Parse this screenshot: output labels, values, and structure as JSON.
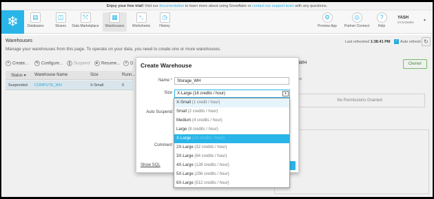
{
  "banner": {
    "lead": "Enjoy your free trial!",
    "pre": " Visit our ",
    "doc_link": "documentation",
    "mid": " to learn more about using Snowflake or ",
    "support_link": "contact our support team",
    "post": " with any questions."
  },
  "nav": {
    "logo": "❄",
    "items": [
      {
        "label": "Databases",
        "icon": "database-icon",
        "glyph": "▤"
      },
      {
        "label": "Shares",
        "icon": "shares-icon",
        "glyph": "◫"
      },
      {
        "label": "Data Marketplace",
        "icon": "marketplace-icon",
        "glyph": "⤲"
      },
      {
        "label": "Warehouses",
        "icon": "warehouse-icon",
        "glyph": "▦"
      },
      {
        "label": "Worksheets",
        "icon": "worksheet-icon",
        "glyph": ">_"
      },
      {
        "label": "History",
        "icon": "history-icon",
        "glyph": "◷"
      }
    ],
    "right_items": [
      {
        "label": "Preview App",
        "icon": "preview-app-icon",
        "glyph": "⚙"
      },
      {
        "label": "Partner Connect",
        "icon": "partner-connect-icon",
        "glyph": "◎"
      },
      {
        "label": "Help",
        "icon": "help-icon",
        "glyph": "?"
      }
    ],
    "user": {
      "name": "YASH",
      "role": "SYSADMIN",
      "caret": "▾"
    }
  },
  "page": {
    "title": "Warehouses",
    "description": "Manage your warehouses from this page. To operate on your data, you need to create one or more warehouses.",
    "last_refreshed_label": "Last refreshed",
    "last_refreshed_time": "1:38:41 PM",
    "auto_refresh": "Auto refresh",
    "refresh_glyph": "↻"
  },
  "toolbar": {
    "create": "Create...",
    "configure": "Configure...",
    "suspend": "Suspend",
    "resume": "Resume...",
    "drop": "D"
  },
  "table": {
    "headers": [
      "Status ▾",
      "Warehouse Name",
      "Size",
      "Runn..."
    ],
    "rows": [
      {
        "status": "Suspended",
        "name": "COMPUTE_WH",
        "size": "X-Small",
        "running": "0"
      }
    ]
  },
  "right_panel": {
    "title": "E_WH",
    "owner": "Owner",
    "subtitle": "leges",
    "no_permissions": "No Permissions Granted",
    "frag": "s"
  },
  "modal": {
    "title": "Create Warehouse",
    "name_label": "Name",
    "name_required": "*",
    "name_value": "Storage_WH",
    "size_label": "Size",
    "size_value": "X-Large  (16 credits / hour)",
    "auto_suspend_label": "Auto Suspend",
    "comment_label": "Comment",
    "show_sql": "Show SQL",
    "caret": "▾"
  },
  "size_options": [
    {
      "size": "X-Small",
      "credits": " (1 credit / hour)"
    },
    {
      "size": "Small",
      "credits": " (2 credits / hour)"
    },
    {
      "size": "Medium",
      "credits": " (4 credits / hour)"
    },
    {
      "size": "Large",
      "credits": " (8 credits / hour)"
    },
    {
      "size": "X-Large",
      "credits": " (16 credits / hour)"
    },
    {
      "size": "2X-Large",
      "credits": " (32 credits / hour)"
    },
    {
      "size": "3X-Large",
      "credits": " (64 credits / hour)"
    },
    {
      "size": "4X-Large",
      "credits": " (128 credits / hour)"
    },
    {
      "size": "5X-Large",
      "credits": " (256 credits / hour)"
    },
    {
      "size": "6X-Large",
      "credits": " (512 credits / hour)"
    }
  ],
  "size_state": {
    "highlighted": "X-Small",
    "selected": "X-Large"
  },
  "colors": {
    "accent": "#29b5e8",
    "owner_green": "#4a9d3d"
  }
}
